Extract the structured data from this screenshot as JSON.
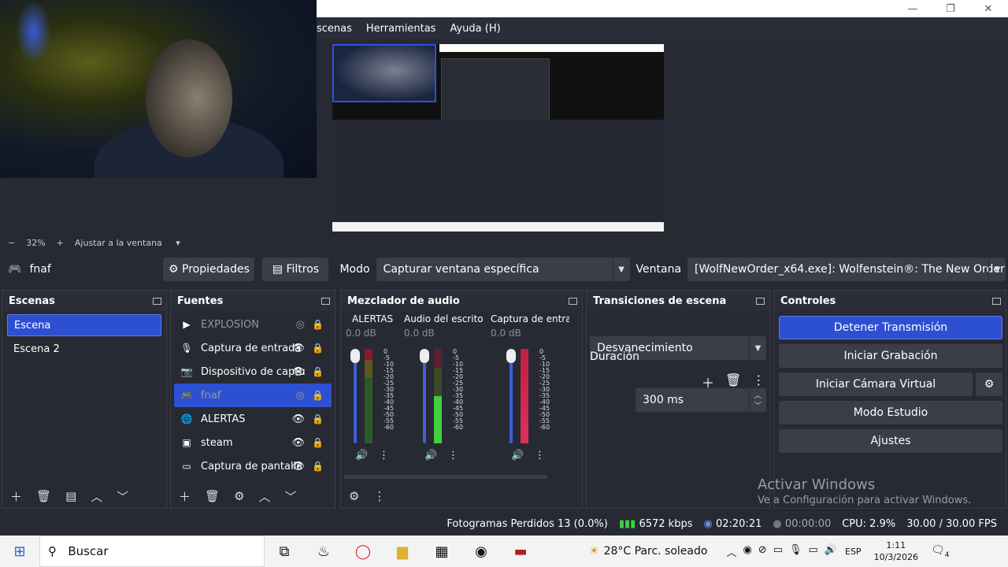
{
  "menu": [
    "scenas",
    "Herramientas",
    "Ayuda (H)"
  ],
  "zoom": {
    "minus": "−",
    "value": "32%",
    "plus": "+",
    "fit": "Ajustar a la ventana"
  },
  "source_bar": {
    "source_name": "fnaf",
    "properties": "Propiedades",
    "filters": "Filtros",
    "mode_label": "Modo",
    "mode_value": "Capturar ventana específica",
    "window_label": "Ventana",
    "window_value": "[WolfNewOrder_x64.exe]: Wolfenstein®: The New Order"
  },
  "scenes": {
    "title": "Escenas",
    "items": [
      "Escena",
      "Escena 2"
    ]
  },
  "sources": {
    "title": "Fuentes",
    "items": [
      {
        "name": "EXPLOSION",
        "icon": "play-icon"
      },
      {
        "name": "Captura de entrada",
        "icon": "microphone-icon"
      },
      {
        "name": "Dispositivo de captu",
        "icon": "camera-icon"
      },
      {
        "name": "fnaf",
        "icon": "gamepad-icon"
      },
      {
        "name": "ALERTAS",
        "icon": "globe-icon"
      },
      {
        "name": "steam",
        "icon": "window-icon"
      },
      {
        "name": "Captura de pantalla",
        "icon": "monitor-icon"
      }
    ]
  },
  "mixer": {
    "title": "Mezclador de audio",
    "channels": [
      {
        "name": "ALERTAS",
        "db": "0.0 dB"
      },
      {
        "name": "Audio del escritorio",
        "db": "0.0 dB"
      },
      {
        "name": "Captura de entrada",
        "db": "0.0 dB"
      }
    ],
    "scale": [
      "0",
      "-5",
      "-10",
      "-15",
      "-20",
      "-25",
      "-30",
      "-35",
      "-40",
      "-45",
      "-50",
      "-55",
      "-60"
    ]
  },
  "transitions": {
    "title": "Transiciones de escena",
    "type": "Desvanecimiento",
    "duration_label": "Duración",
    "duration_value": "300 ms"
  },
  "controls": {
    "title": "Controles",
    "stop_stream": "Detener Transmisión",
    "start_record": "Iniciar Grabación",
    "virtual_cam": "Iniciar Cámara Virtual",
    "studio": "Modo Estudio",
    "settings": "Ajustes"
  },
  "status": {
    "dropped": "Fotogramas Perdidos 13 (0.0%)",
    "bitrate": "6572 kbps",
    "stream_time": "02:20:21",
    "rec_time": "00:00:00",
    "cpu": "CPU: 2.9%",
    "fps": "30.00 / 30.00 FPS"
  },
  "watermark": {
    "title": "Activar Windows",
    "subtitle": "Ve a Configuración para activar Windows."
  },
  "taskbar": {
    "search": "Buscar",
    "weather": "28°C  Parc. soleado",
    "lang": "ESP",
    "time": "1:11",
    "date": "10/3/2026",
    "notif": "4"
  },
  "colors": {
    "accent": "#2d50d2",
    "panel": "#272a33",
    "button": "#3b3e49"
  }
}
